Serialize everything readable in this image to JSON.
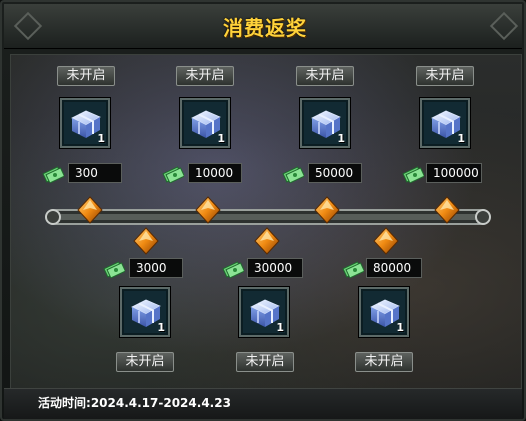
{
  "title": "消费返奖",
  "top_row": [
    {
      "status": "未开启",
      "qty": "1",
      "amount": "300"
    },
    {
      "status": "未开启",
      "qty": "1",
      "amount": "10000"
    },
    {
      "status": "未开启",
      "qty": "1",
      "amount": "50000"
    },
    {
      "status": "未开启",
      "qty": "1",
      "amount": "100000"
    }
  ],
  "bottom_row": [
    {
      "status": "未开启",
      "qty": "1",
      "amount": "3000"
    },
    {
      "status": "未开启",
      "qty": "1",
      "amount": "30000"
    },
    {
      "status": "未开启",
      "qty": "1",
      "amount": "80000"
    }
  ],
  "period": {
    "label": "活动时间",
    "value": ":2024.4.17-2024.4.23"
  },
  "icons": {
    "reward": "gift-box-icon",
    "currency": "cash-icon",
    "milestone": "orange-diamond-icon"
  },
  "colors": {
    "title": "#ffd23a",
    "milestone": "#f29a1a",
    "gift": "#8fb8ff"
  }
}
